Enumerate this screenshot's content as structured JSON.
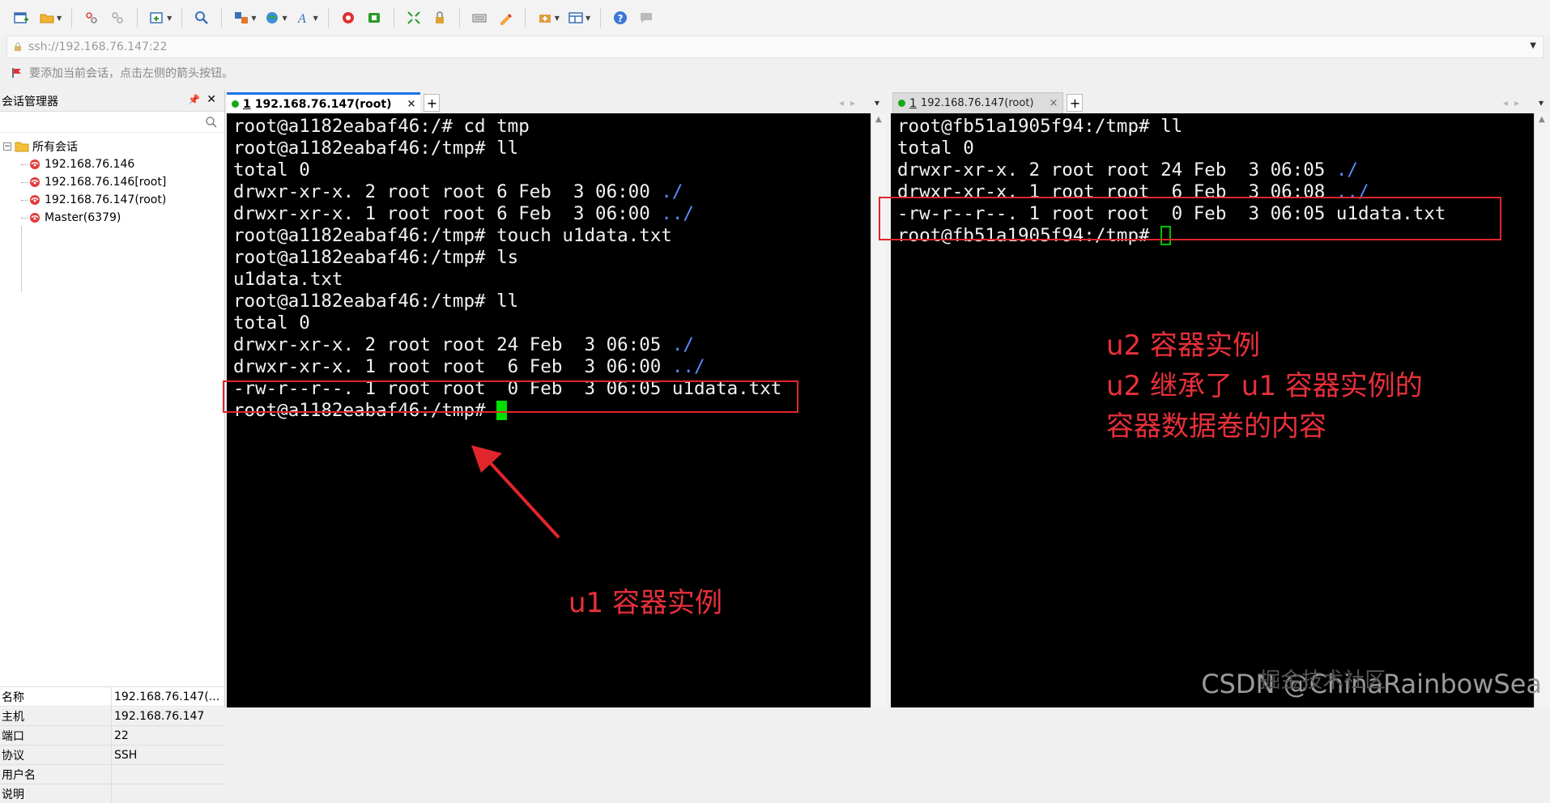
{
  "address_bar": {
    "value": "ssh://192.168.76.147:22"
  },
  "hint": {
    "text": "要添加当前会话，点击左侧的箭头按钮。"
  },
  "session_manager": {
    "title": "会话管理器",
    "root_label": "所有会话",
    "sessions": [
      "192.168.76.146",
      "192.168.76.146[root]",
      "192.168.76.147(root)",
      "Master(6379)"
    ],
    "properties": [
      {
        "key": "名称",
        "value": "192.168.76.147(..."
      },
      {
        "key": "主机",
        "value": "192.168.76.147"
      },
      {
        "key": "端口",
        "value": "22"
      },
      {
        "key": "协议",
        "value": "SSH"
      },
      {
        "key": "用户名",
        "value": ""
      },
      {
        "key": "说明",
        "value": ""
      }
    ]
  },
  "left_pane": {
    "tab": {
      "number": "1",
      "label": "192.168.76.147(root)",
      "close": "×"
    },
    "plus": "+",
    "lines": [
      {
        "text": "root@a1182eabaf46:/# cd tmp"
      },
      {
        "text": "root@a1182eabaf46:/tmp# ll"
      },
      {
        "text": "total 0"
      },
      {
        "text": "drwxr-xr-x. 2 root root 6 Feb  3 06:00 ",
        "link": "./"
      },
      {
        "text": "drwxr-xr-x. 1 root root 6 Feb  3 06:00 ",
        "link": "../"
      },
      {
        "text": "root@a1182eabaf46:/tmp# touch u1data.txt"
      },
      {
        "text": "root@a1182eabaf46:/tmp# ls"
      },
      {
        "text": "u1data.txt"
      },
      {
        "text": "root@a1182eabaf46:/tmp# ll"
      },
      {
        "text": "total 0"
      },
      {
        "text": "drwxr-xr-x. 2 root root 24 Feb  3 06:05 ",
        "link": "./"
      },
      {
        "text": "drwxr-xr-x. 1 root root  6 Feb  3 06:00 ",
        "link": "../"
      },
      {
        "text": "-rw-r--r--. 1 root root  0 Feb  3 06:05 u1data.txt"
      },
      {
        "text": "root@a1182eabaf46:/tmp# ",
        "cursor": "filled"
      }
    ],
    "annotation": [
      "u1 容器实例"
    ]
  },
  "right_pane": {
    "tab": {
      "number": "1",
      "label": "192.168.76.147(root)",
      "close": "×"
    },
    "plus": "+",
    "lines": [
      {
        "text": "root@fb51a1905f94:/tmp# ll"
      },
      {
        "text": "total 0"
      },
      {
        "text": "drwxr-xr-x. 2 root root 24 Feb  3 06:05 ",
        "link": "./"
      },
      {
        "text": "drwxr-xr-x. 1 root root  6 Feb  3 06:08 ",
        "link": "../"
      },
      {
        "text": "-rw-r--r--. 1 root root  0 Feb  3 06:05 u1data.txt"
      },
      {
        "text": "root@fb51a1905f94:/tmp# ",
        "cursor": "hollow"
      }
    ],
    "annotation": [
      "u2 容器实例",
      "u2 继承了 u1 容器实例的",
      "容器数据卷的内容"
    ]
  },
  "watermark": "CSDN @ChinaRainbowSea",
  "watermark_overlay": "掘金技术社区",
  "colors": {
    "annotation": "#e8303a",
    "tab_accent": "#1a73e8",
    "cursor": "#00e000",
    "link": "#5b8cff"
  }
}
